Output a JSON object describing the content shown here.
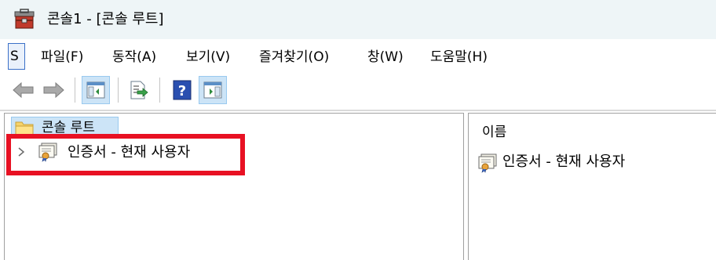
{
  "window": {
    "title": "콘솔1 - [콘솔 루트]",
    "app_icon": "mmc-toolbox-icon"
  },
  "menubar": {
    "system_menu_label": "S",
    "items": [
      {
        "label": "파일(F)"
      },
      {
        "label": "동작(A)"
      },
      {
        "label": "보기(V)"
      },
      {
        "label": "즐겨찾기(O)"
      },
      {
        "label": "창(W)"
      },
      {
        "label": "도움말(H)"
      }
    ]
  },
  "toolbar": {
    "buttons": [
      {
        "icon": "back-arrow-icon",
        "enabled": false
      },
      {
        "icon": "forward-arrow-icon",
        "enabled": false
      },
      {
        "icon": "show-hide-console-tree-icon",
        "pressed": true
      },
      {
        "icon": "export-list-icon"
      },
      {
        "icon": "help-icon"
      },
      {
        "icon": "show-hide-action-pane-icon",
        "pressed": true
      }
    ]
  },
  "tree": {
    "root": {
      "label": "콘솔 루트",
      "icon": "folder-icon",
      "selected": true
    },
    "children": [
      {
        "label": "인증서 - 현재 사용자",
        "icon": "certificate-icon",
        "expandable": true,
        "highlighted": true
      }
    ]
  },
  "list": {
    "column_header": "이름",
    "items": [
      {
        "label": "인증서 - 현재 사용자",
        "icon": "certificate-icon"
      }
    ]
  },
  "colors": {
    "titlebar_bg": "#eef5f7",
    "selection_bg": "#cce4f7",
    "highlight_border": "#e81123"
  }
}
